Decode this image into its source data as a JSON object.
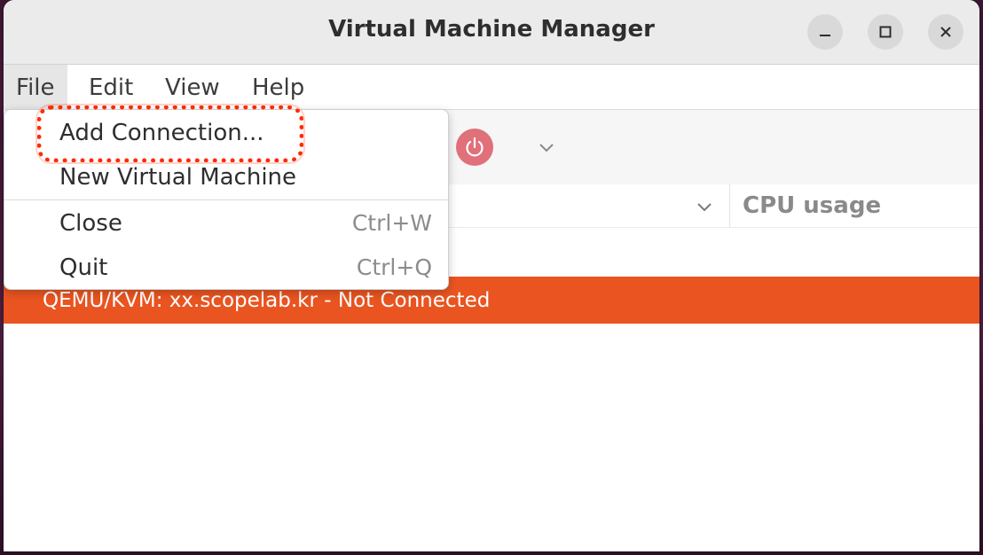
{
  "window": {
    "title": "Virtual Machine Manager"
  },
  "menubar": {
    "items": [
      {
        "label": "File"
      },
      {
        "label": "Edit"
      },
      {
        "label": "View"
      },
      {
        "label": "Help"
      }
    ]
  },
  "file_menu": {
    "items": [
      {
        "label": "Add Connection...",
        "accel": ""
      },
      {
        "label": "New Virtual Machine",
        "accel": ""
      },
      {
        "label": "Close",
        "accel": "Ctrl+W"
      },
      {
        "label": "Quit",
        "accel": "Ctrl+Q"
      }
    ]
  },
  "list": {
    "columns": [
      "CPU usage"
    ],
    "connections": [
      {
        "label": "QEMU/KVM: xx.scopelab.kr - Not Connected"
      }
    ]
  },
  "icons": {
    "power": "power-icon",
    "dropdown": "chevron-down-icon",
    "minimize": "minimize-icon",
    "maximize": "maximize-icon",
    "close": "close-icon"
  },
  "colors": {
    "accent": "#e95420",
    "highlight_annotation": "#ff2a00"
  }
}
